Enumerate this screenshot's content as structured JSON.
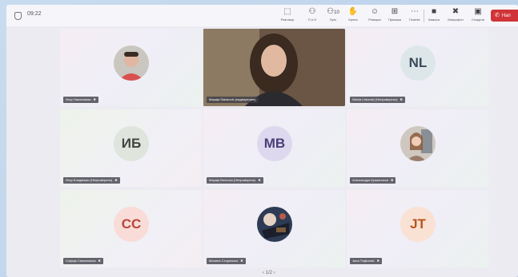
{
  "header": {
    "time": "09:22",
    "toolbar": [
      {
        "name": "chat-button",
        "icon": "chat-icon",
        "glyph": "⬚",
        "label": "Разговор"
      },
      {
        "name": "people-button",
        "icon": "people-icon",
        "glyph": "⚇",
        "label": "П и О"
      },
      {
        "name": "participants-button",
        "icon": "participants-icon",
        "glyph": "⚇",
        "label": "Луѓе"
      },
      {
        "name": "raise-hand-button",
        "icon": "hand-icon",
        "glyph": "✋",
        "label": "Крена"
      },
      {
        "name": "react-button",
        "icon": "smile-icon",
        "glyph": "☺",
        "label": "Реакции"
      },
      {
        "name": "view-button",
        "icon": "grid-icon",
        "glyph": "⊞",
        "label": "Прикажи"
      },
      {
        "name": "more-button",
        "icon": "more-icon",
        "glyph": "⋯",
        "label": "Повеќе"
      },
      {
        "name": "camera-button",
        "icon": "camera-icon",
        "glyph": "■",
        "label": "Камера"
      },
      {
        "name": "mic-button",
        "icon": "mic-icon",
        "glyph": "✖",
        "label": "Микрофон"
      },
      {
        "name": "share-button",
        "icon": "share-icon",
        "glyph": "▣",
        "label": "Сподели"
      }
    ],
    "participants_count": "10",
    "leave_label": "Нап"
  },
  "tiles": [
    {
      "type": "photo",
      "name": "Игор Николовски",
      "initials": "",
      "bg": "",
      "fg": ""
    },
    {
      "type": "video",
      "name": "Марија Stanković (надворешен)",
      "initials": "",
      "bg": "",
      "fg": ""
    },
    {
      "type": "initials",
      "name": "Nikola Lekovski (Непроверено)",
      "initials": "NL",
      "bg": "#dde7ea",
      "fg": "#3a4a58"
    },
    {
      "type": "initials",
      "name": "Игор Бледвиски (Непроверено)",
      "initials": "ИБ",
      "bg": "#dfe4dc",
      "fg": "#444"
    },
    {
      "type": "initials",
      "name": "Марија Велеска (Непроверено)",
      "initials": "МВ",
      "bg": "#ddd8ee",
      "fg": "#4b3f7a"
    },
    {
      "type": "photo",
      "name": "Александра Кузманоска",
      "initials": "",
      "bg": "",
      "fg": ""
    },
    {
      "type": "initials",
      "name": "Софија Симоновска",
      "initials": "СС",
      "bg": "#f9dcd8",
      "fg": "#b7453a"
    },
    {
      "type": "photo",
      "name": "Малина Стојаноска",
      "initials": "",
      "bg": "",
      "fg": ""
    },
    {
      "type": "initials",
      "name": "Jana Trajkovski",
      "initials": "JT",
      "bg": "#f9e1d3",
      "fg": "#b9541e"
    }
  ],
  "pager": "‹ 1/2 ›"
}
